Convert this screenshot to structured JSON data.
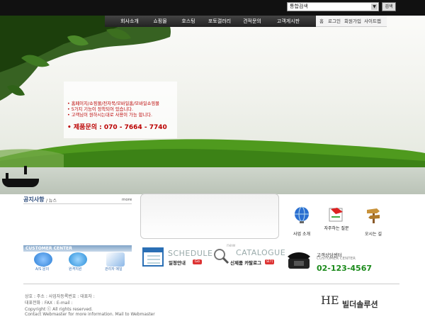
{
  "search": {
    "select_value": "통합검색",
    "button_label": "검색"
  },
  "nav": [
    "회사소개",
    "쇼핑몰",
    "호스팅",
    "포토갤러리",
    "견적문의",
    "고객게시판"
  ],
  "util_links": [
    "홈",
    "로그인",
    "회원가입",
    "사이트맵"
  ],
  "hero": {
    "lines": [
      "• 홈페이지/쇼핑몰/전자북/모바일홈/모바일쇼핑몰",
      "• 5가지 기능이 장착되어 있습니다.",
      "• 고객님이 원하시는대로 사용이 가능 합니다."
    ],
    "phone": "• 제품문의 : 070 - 7664 - 7740"
  },
  "notice": {
    "title": "공지사항",
    "subtitle": "/ 뉴스",
    "more": "more"
  },
  "quick_links": [
    {
      "label": "사업 소개",
      "icon": "globe-icon"
    },
    {
      "label": "자주하는 질문",
      "icon": "faq-note-icon"
    },
    {
      "label": "오시는 길",
      "icon": "signpost-icon"
    }
  ],
  "customer_center": {
    "header": "CUSTOMER CENTER",
    "items": [
      {
        "label": "A/S 문의",
        "icon": "magnifier-icon"
      },
      {
        "label": "원격지원",
        "icon": "www-icon"
      },
      {
        "label": "관리자 메일",
        "icon": "mail-icon"
      }
    ]
  },
  "schedule": {
    "title": "SCHEDULE",
    "subtitle": "일정안내",
    "badge": "Go"
  },
  "catalogue": {
    "new_label": "new",
    "title": "CATALOGUE",
    "subtitle": "신제품 카탈로그",
    "badge": "보기"
  },
  "consult": {
    "label": "고객상담센터",
    "eng": "CUSTOMER CENTER",
    "phone": "02-123-4567"
  },
  "footer": {
    "line1": "상호 : 주소 : 사업자등록번호 : 대표자 :",
    "line2": "대표전화 : FAX : E-mail :",
    "line3": "Copyright ⓒ All rights reserved.",
    "line4": "Contact Webmaster for more information. Mail to Webmaster"
  },
  "logo": {
    "mark": "HE",
    "name": "빌더솔루션"
  }
}
